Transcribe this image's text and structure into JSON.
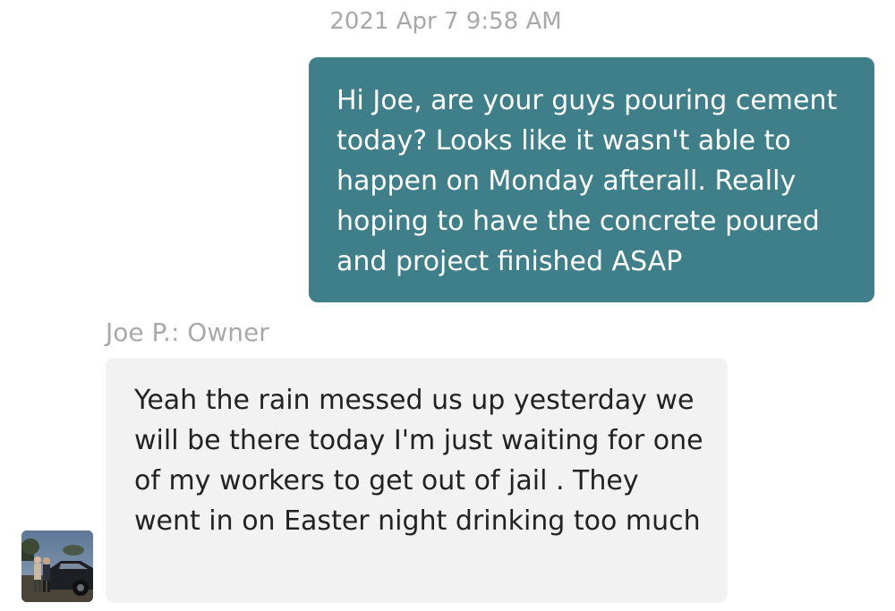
{
  "conversation": {
    "timestamp": "2021 Apr 7 9:58 AM",
    "outgoing_message": "Hi Joe, are your guys pouring cement today? Looks like it wasn't able to happen on Monday afterall. Really hoping to have the concrete poured and project finished ASAP",
    "sender_label": "Joe P.: Owner",
    "incoming_message": "Yeah the rain messed us up yesterday we will be there today I'm just waiting for one of my workers to get out of jail . They went in on Easter night drinking too much"
  },
  "colors": {
    "outgoing_bubble": "#3f7f8a",
    "incoming_bubble": "#f2f2f2",
    "meta_text": "#a9a9a9"
  },
  "icons": {
    "avatar": "avatar-photo"
  }
}
